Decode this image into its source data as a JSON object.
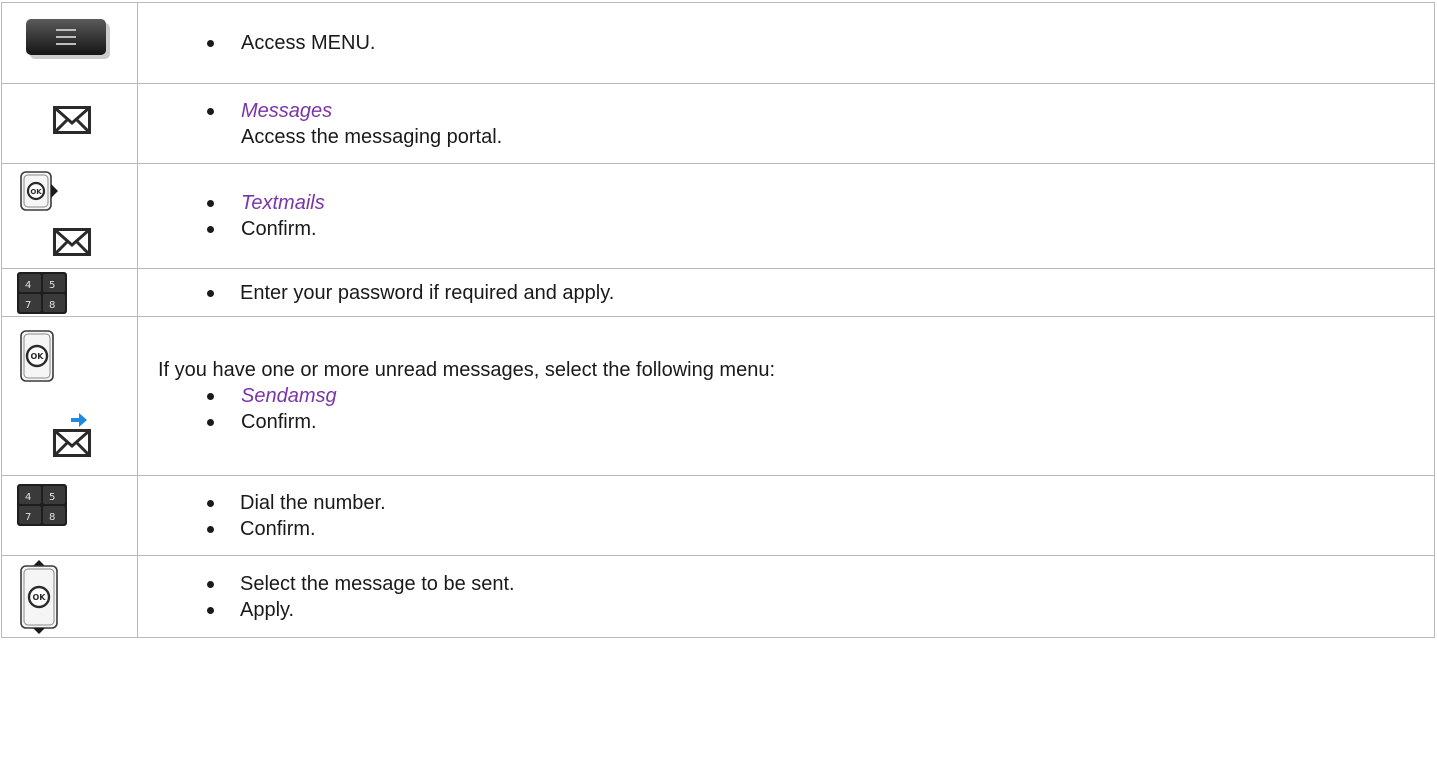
{
  "rows": [
    {
      "icon": "menu-button-icon",
      "bullets": [
        "Access MENU."
      ]
    },
    {
      "icon": "envelope-icon",
      "option": "Messages",
      "detail": "Access the messaging portal."
    },
    {
      "icons": [
        "ok-right-button-icon",
        "envelope-icon"
      ],
      "option": "Textmails",
      "bullets": [
        "Confirm."
      ]
    },
    {
      "icon": "keypad-icon",
      "bullets": [
        "Enter your password if required and apply."
      ]
    },
    {
      "icons": [
        "ok-button-icon",
        "envelope-send-icon"
      ],
      "intro": "If you have one or more unread messages, select the following menu:",
      "option": "Sendamsg",
      "bullets": [
        "Confirm."
      ]
    },
    {
      "icon": "keypad-icon",
      "bullets": [
        "Dial the number.",
        "Confirm."
      ]
    },
    {
      "icon": "ok-up-down-button-icon",
      "bullets": [
        "Select the message to be sent.",
        "Apply."
      ]
    }
  ],
  "colors": {
    "option_text": "#7a35a8",
    "border": "#b9b9b9",
    "text": "#1a1a1a"
  }
}
